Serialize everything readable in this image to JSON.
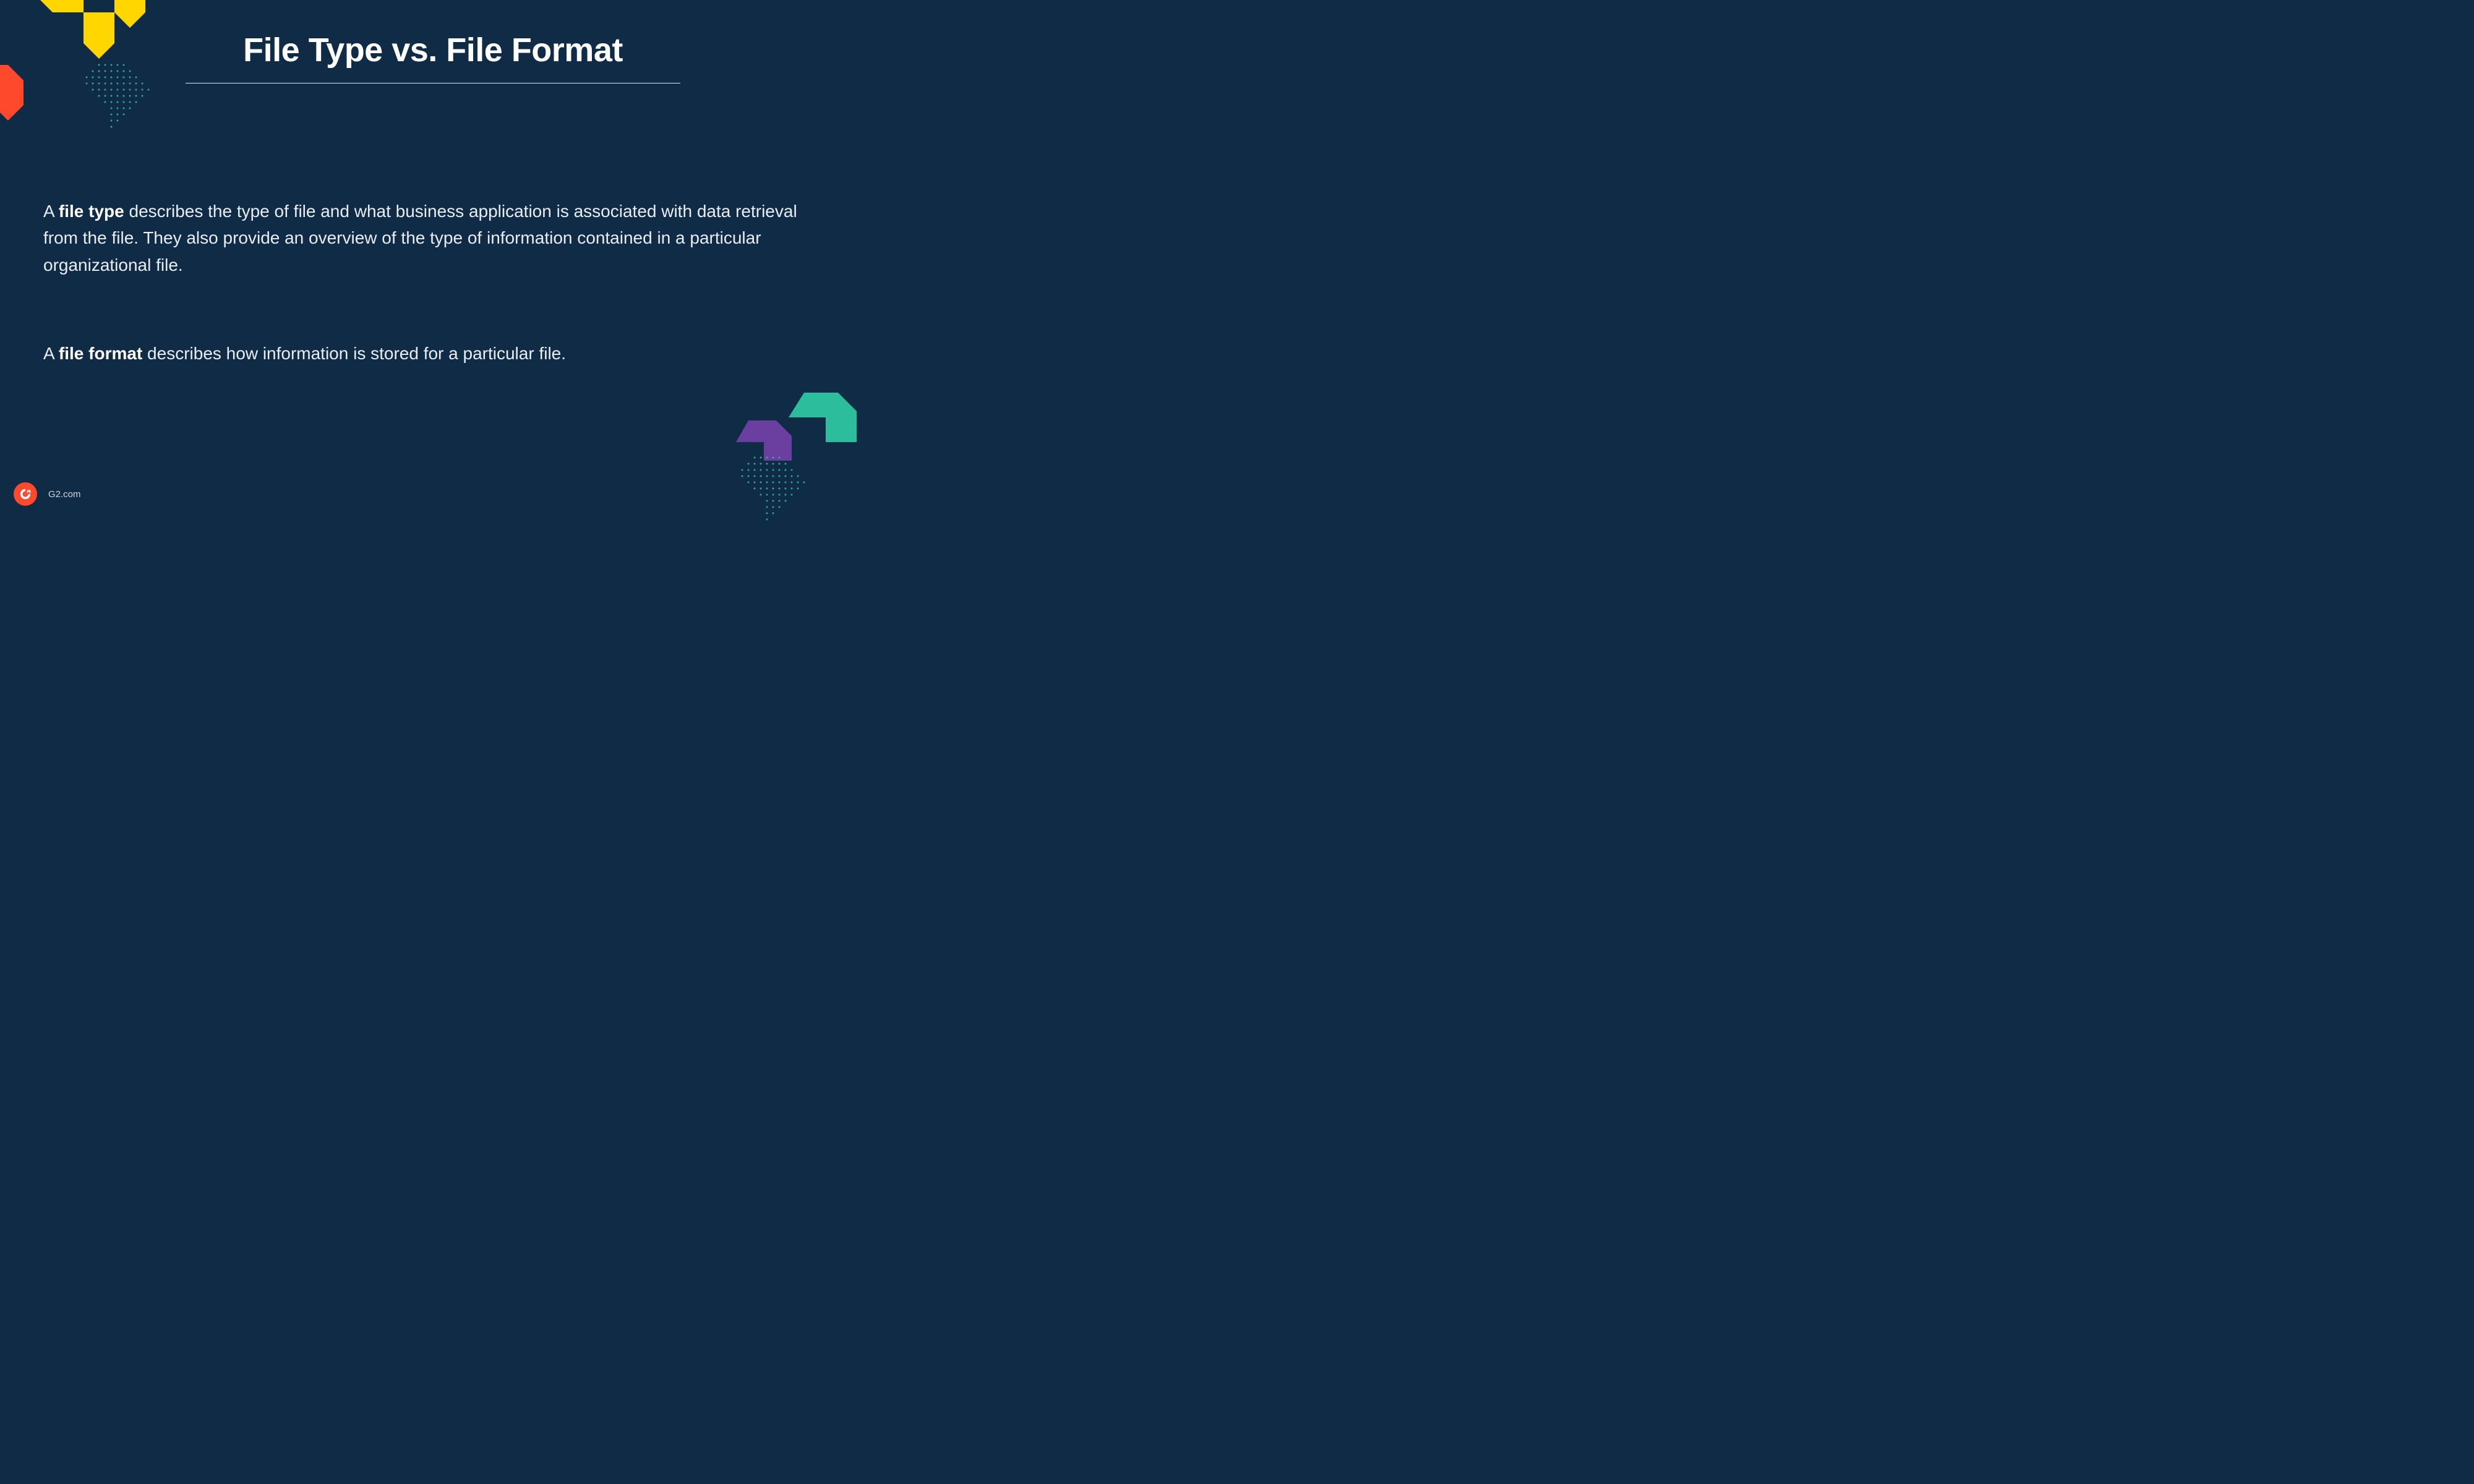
{
  "title": "File Type vs. File Format",
  "paragraphs": {
    "p1_prefix": "A ",
    "p1_bold": "file type",
    "p1_rest": " describes the type of file and what business application is associated with data retrieval from the  file. They also provide an overview of the type of information contained in a particular organizational file.",
    "p2_prefix": "A ",
    "p2_bold": "file format",
    "p2_rest": " describes how information is stored for a particular file."
  },
  "footer": {
    "site": "G2.com"
  },
  "colors": {
    "background": "#0f2b46",
    "yellow": "#ffd600",
    "red": "#ff492c",
    "teal": "#2bbd9c",
    "purple": "#6b3fa0"
  }
}
